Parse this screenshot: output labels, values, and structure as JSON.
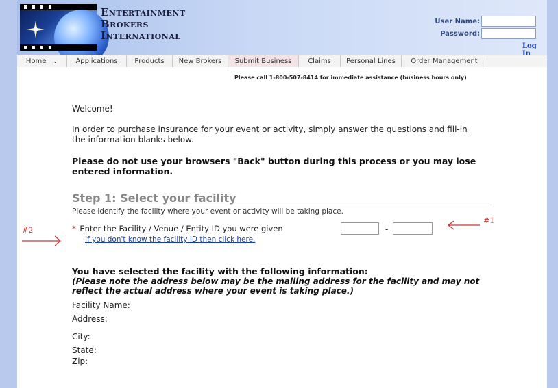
{
  "header": {
    "logo_lines": [
      "Entertainment",
      "Brokers",
      "International"
    ],
    "username_label": "User Name:",
    "password_label": "Password:",
    "login_link": "Log In"
  },
  "nav": {
    "items": [
      {
        "label": "Home",
        "dropdown": true
      },
      {
        "label": "Applications"
      },
      {
        "label": "Products"
      },
      {
        "label": "New Brokers"
      },
      {
        "label": "Submit Business",
        "active": true
      },
      {
        "label": "Claims"
      },
      {
        "label": "Personal Lines"
      },
      {
        "label": "Order Management"
      }
    ]
  },
  "main": {
    "assistance": "Please call 1-800-507-8414 for immediate assistance (business hours only)",
    "welcome": "Welcome!",
    "intro": "In order to purchase insurance for your event or activity, simply answer the questions and fill-in the information blanks below.",
    "warning": "Please do not use your browsers \"Back\" button during this process or you may lose entered information.",
    "step_title": "Step 1: Select your facility",
    "step_desc": "Please identify the facility where your event or activity will be taking place.",
    "required_marker": "*",
    "facility_prompt": "Enter the Facility / Venue / Entity ID you were given",
    "id_separator": "-",
    "facility_link": "If you don't know the facility ID then click here.",
    "selected_heading": "You have selected the facility with the following information:",
    "selected_note": "(Please note the address below may be the mailing address for the facility and may not reflect the actual address where your event is taking place.)",
    "fields": {
      "name": "Facility Name:",
      "address": "Address:",
      "city": "City:",
      "state": "State:",
      "zip": "Zip:"
    }
  },
  "annotations": {
    "label_1": "#1",
    "label_2": "#2",
    "color": "#d33333"
  }
}
